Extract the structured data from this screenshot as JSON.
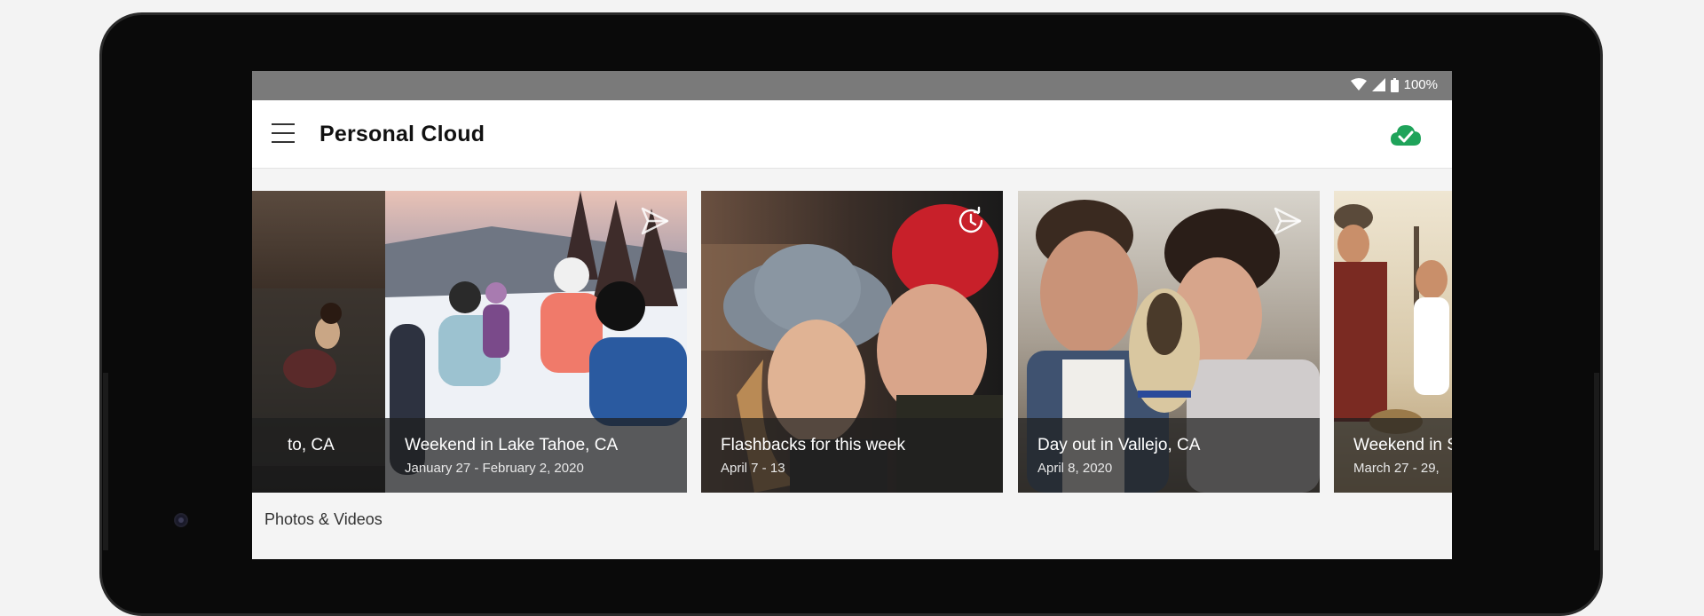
{
  "status_bar": {
    "battery": "100%"
  },
  "app_bar": {
    "title": "Personal Cloud"
  },
  "stories": [
    {
      "title": "to, CA",
      "date": "",
      "badge": "send-icon"
    },
    {
      "title": "Weekend in Lake Tahoe, CA",
      "date": "January 27 - February 2, 2020",
      "badge": "send-icon"
    },
    {
      "title": "Flashbacks for this week",
      "date": "April 7 - 13",
      "badge": "history-clock-icon"
    },
    {
      "title": "Day out in Vallejo, CA",
      "date": "April 8, 2020",
      "badge": "send-icon"
    },
    {
      "title": "Weekend in S",
      "date": "March 27 - 29,",
      "badge": ""
    }
  ],
  "section": {
    "label": "Photos & Videos"
  },
  "colors": {
    "accent": "#1fa35a",
    "status_bar": "#7a7a7a"
  }
}
